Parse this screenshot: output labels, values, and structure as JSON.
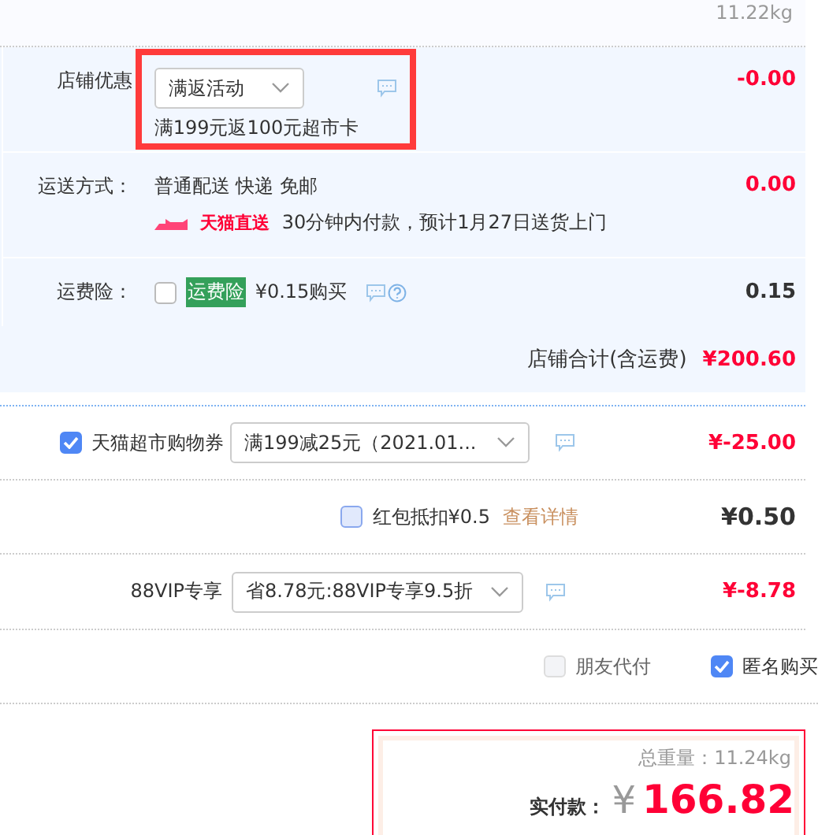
{
  "header": {
    "weight": "11.22kg"
  },
  "store_discount": {
    "label": "店铺优惠",
    "select": "满返活动",
    "note": "满199元返100元超市卡",
    "amount": "-0.00",
    "highlighted": true
  },
  "shipping": {
    "label": "运送方式：",
    "method": "普通配送 快递 免邮",
    "badge": "天猫直送",
    "eta": "30分钟内付款，预计1月27日送货上门",
    "amount": "0.00"
  },
  "insurance": {
    "label": "运费险：",
    "checked": false,
    "tag": "运费险",
    "price": "¥0.15购买",
    "amount": "0.15"
  },
  "store_total": {
    "label": "店铺合计(含运费)",
    "amount": "¥200.60"
  },
  "coupon": {
    "checked": true,
    "label": "天猫超市购物券",
    "select": "满199减25元（2021.01...",
    "amount": "¥-25.00"
  },
  "red_packet": {
    "checked": false,
    "label": "红包抵扣¥0.5",
    "link": "查看详情",
    "amount": "¥0.50"
  },
  "vip": {
    "label": "88VIP专享",
    "select": "省8.78元:88VIP专享9.5折",
    "amount": "¥-8.78"
  },
  "options": [
    {
      "label": "朋友代付",
      "checked": false,
      "disabled": true
    },
    {
      "label": "匿名购买",
      "checked": true,
      "disabled": false
    }
  ],
  "summary": {
    "weight": "总重量：11.24kg",
    "pay_label": "实付款：",
    "currency": "¥",
    "total": "166.82"
  }
}
